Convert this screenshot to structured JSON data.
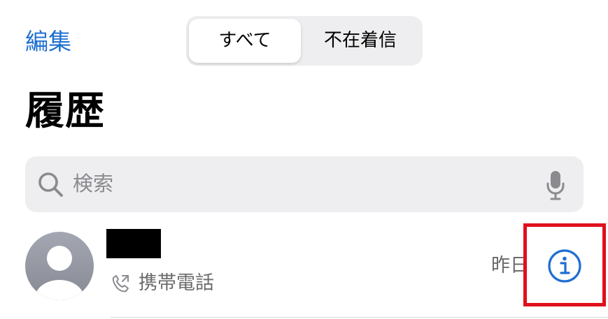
{
  "header": {
    "edit_label": "編集",
    "segments": [
      "すべて",
      "不在着信"
    ],
    "selected_segment": "すべて"
  },
  "page_title": "履歴",
  "search": {
    "placeholder": "検索"
  },
  "recents": [
    {
      "call_type": "携帯電話",
      "date": "昨日"
    }
  ],
  "colors": {
    "accent": "#1f6fd0",
    "highlight": "#e0101c",
    "secondary_text": "#6b6b6b",
    "search_bg": "#eeeef0"
  },
  "icons": [
    "search-icon",
    "microphone-icon",
    "contact-avatar-icon",
    "phone-outgoing-icon",
    "info-icon"
  ]
}
